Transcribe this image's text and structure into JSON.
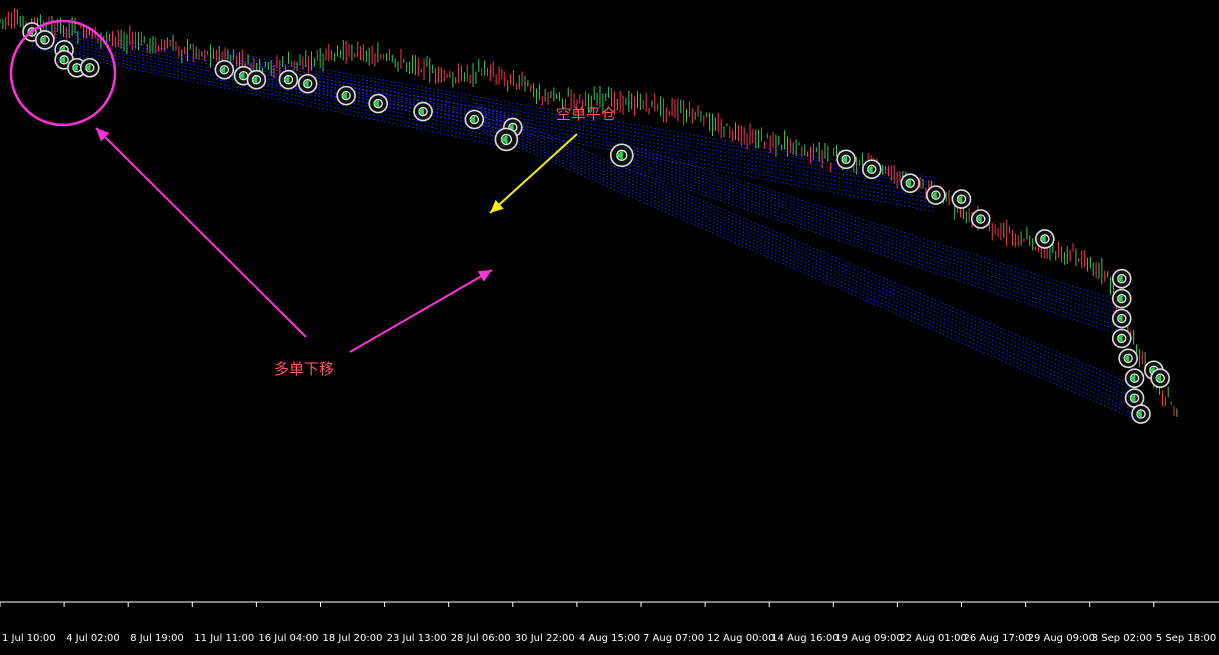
{
  "chart_data": {
    "type": "candlestick",
    "timeframe_labels": [
      "1 Jul 10:00",
      "4 Jul 02:00",
      "8 Jul 19:00",
      "11 Jul 11:00",
      "16 Jul 04:00",
      "18 Jul 20:00",
      "23 Jul 13:00",
      "28 Jul 06:00",
      "30 Jul 22:00",
      "4 Aug 15:00",
      "7 Aug 07:00",
      "12 Aug 00:00",
      "14 Aug 16:00",
      "19 Aug 09:00",
      "22 Aug 01:00",
      "26 Aug 17:00",
      "29 Aug 09:00",
      "3 Sep 02:00",
      "5 Sep 18:00"
    ],
    "price_path": [
      [
        0,
        0.9
      ],
      [
        0.5,
        0.93
      ],
      [
        1.0,
        0.94
      ],
      [
        1.5,
        0.98
      ],
      [
        2.0,
        1.0
      ],
      [
        2.5,
        1.03
      ],
      [
        3.0,
        1.05
      ],
      [
        3.5,
        1.08
      ],
      [
        4.0,
        1.15
      ],
      [
        4.5,
        1.12
      ],
      [
        5.0,
        1.1
      ],
      [
        5.5,
        1.05
      ],
      [
        6.0,
        1.1
      ],
      [
        6.5,
        1.12
      ],
      [
        7.0,
        1.2
      ],
      [
        7.5,
        1.15
      ],
      [
        8.0,
        1.2
      ],
      [
        8.5,
        1.28
      ],
      [
        9.0,
        1.3
      ],
      [
        9.5,
        1.3
      ],
      [
        10.0,
        1.32
      ],
      [
        10.5,
        1.35
      ],
      [
        11.0,
        1.4
      ],
      [
        11.5,
        1.48
      ],
      [
        12.0,
        1.5
      ],
      [
        12.5,
        1.55
      ],
      [
        13.0,
        1.6
      ],
      [
        13.5,
        1.62
      ],
      [
        14.0,
        1.68
      ],
      [
        14.5,
        1.75
      ],
      [
        15.0,
        1.85
      ],
      [
        15.5,
        1.95
      ],
      [
        16.0,
        2.0
      ],
      [
        16.5,
        2.08
      ],
      [
        17.0,
        2.1
      ],
      [
        17.3,
        2.2
      ],
      [
        17.5,
        2.4
      ],
      [
        17.8,
        2.6
      ],
      [
        18.0,
        2.7
      ],
      [
        18.3,
        2.85
      ],
      [
        18.4,
        2.9
      ]
    ],
    "markers": {
      "sell_close": [
        [
          0.5,
          0.96
        ],
        [
          0.7,
          1.0
        ],
        [
          1.0,
          1.05
        ],
        [
          1.0,
          1.1
        ],
        [
          1.2,
          1.14
        ],
        [
          1.4,
          1.14
        ],
        [
          3.5,
          1.15
        ],
        [
          3.8,
          1.18
        ],
        [
          4.0,
          1.2
        ],
        [
          4.5,
          1.2
        ],
        [
          4.8,
          1.22
        ],
        [
          5.4,
          1.28
        ],
        [
          5.9,
          1.32
        ],
        [
          6.6,
          1.36
        ],
        [
          7.4,
          1.4
        ],
        [
          8.0,
          1.44
        ],
        [
          13.2,
          1.6
        ],
        [
          13.6,
          1.65
        ],
        [
          14.2,
          1.72
        ],
        [
          14.6,
          1.78
        ],
        [
          15.0,
          1.8
        ],
        [
          15.3,
          1.9
        ],
        [
          16.3,
          2.0
        ],
        [
          17.5,
          2.2
        ],
        [
          17.5,
          2.3
        ],
        [
          17.5,
          2.4
        ],
        [
          17.5,
          2.5
        ],
        [
          17.6,
          2.6
        ],
        [
          17.7,
          2.7
        ],
        [
          17.7,
          2.8
        ],
        [
          17.8,
          2.88
        ],
        [
          18.0,
          2.66
        ],
        [
          18.1,
          2.7
        ]
      ],
      "buy_move": [
        [
          7.9,
          1.5
        ],
        [
          9.7,
          1.58
        ]
      ]
    },
    "trendline_groups": [
      {
        "from": [
          0.5,
          0.98
        ],
        "to": [
          8.0,
          1.46
        ]
      },
      {
        "from": [
          3.5,
          1.12
        ],
        "to": [
          14.6,
          1.78
        ]
      },
      {
        "from": [
          7.4,
          1.38
        ],
        "to": [
          17.7,
          2.82
        ]
      },
      {
        "from": [
          9.7,
          1.58
        ],
        "to": [
          17.5,
          2.4
        ]
      }
    ],
    "annotations": [
      {
        "text": "空单平仓",
        "color": "#ff5566"
      },
      {
        "text": "多单下移",
        "color": "#ff5566"
      }
    ],
    "highlight_circle": {
      "color": "#ff33dd"
    },
    "arrow_colors": {
      "yellow": "#f0f000",
      "magenta": "#ff33dd"
    },
    "colors": {
      "bull": "#ff3355",
      "bear": "#33cc55",
      "trendline": "#2233ff",
      "marker_ring": "#dddddd",
      "axis_line": "#ffffff",
      "background": "#000000"
    },
    "grid": false
  }
}
